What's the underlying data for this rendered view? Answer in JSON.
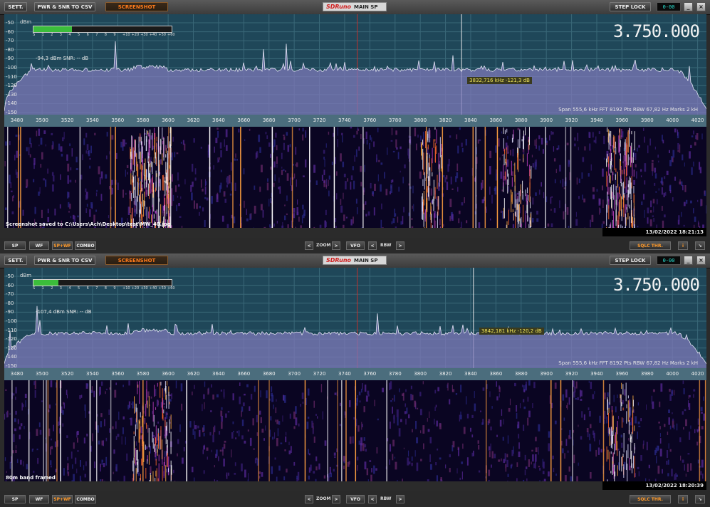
{
  "panels": [
    {
      "toolbar": {
        "sett": "SETT.",
        "pwr_csv": "PWR & SNR TO CSV",
        "screenshot": "SCREENSHOT",
        "brand": "SDRuno",
        "main_sp": "MAIN SP",
        "step_lock": "STEP LOCK",
        "squelch": "0-00",
        "minimize": "_",
        "close": "×"
      },
      "spectrum": {
        "y_labels": [
          "-50",
          "-60",
          "-70",
          "-80",
          "-90",
          "-100",
          "-110",
          "-120",
          "-130",
          "-140",
          "-150"
        ],
        "dbm_label": "dBm",
        "s_scale": [
          "S",
          "1",
          "2",
          "3",
          "4",
          "5",
          "6",
          "7",
          "8",
          "9",
          "+10",
          "+20",
          "+30",
          "+40",
          "+50",
          "+60"
        ],
        "signal_fraction": 0.28,
        "reading": "-94,3 dBm   SNR: -- dB",
        "frequency": "3.750.000",
        "cursor_label": "3832,716 kHz -121,3 dB",
        "cursor_frequency": 3832.716,
        "info": "Span 555,6 kHz   FFT 8192 Pts   RBW 67,82 Hz   Marks 2 kH"
      },
      "x_labels": [
        "3480",
        "3500",
        "3520",
        "3540",
        "3560",
        "3580",
        "3600",
        "3620",
        "3640",
        "3660",
        "3680",
        "3700",
        "3720",
        "3740",
        "3760",
        "3780",
        "3800",
        "3820",
        "3840",
        "3860",
        "3880",
        "3900",
        "3920",
        "3940",
        "3960",
        "3980",
        "4000",
        "4020"
      ],
      "waterfall_message": "Screenshot saved to C:\\Users\\Ach\\Desktop\\test\\MW_40.jpg",
      "timestamp": "13/02/2022 18:21:13",
      "bottom": {
        "sp": "SP",
        "wf": "WF",
        "spwf": "SP+WF",
        "combo": "COMBO",
        "zoom": "ZOOM",
        "vfo": "VFO",
        "rbw": "RBW",
        "prev": "<",
        "next": ">",
        "sqlc": "SQLC THR.",
        "info": "i",
        "resize": "↘"
      }
    },
    {
      "toolbar": {
        "sett": "SETT.",
        "pwr_csv": "PWR & SNR TO CSV",
        "screenshot": "SCREENSHOT",
        "brand": "SDRuno",
        "main_sp": "MAIN SP",
        "step_lock": "STEP LOCK",
        "squelch": "0-00",
        "minimize": "_",
        "close": "×"
      },
      "spectrum": {
        "y_labels": [
          "-50",
          "-60",
          "-70",
          "-80",
          "-90",
          "-100",
          "-110",
          "-120",
          "-130",
          "-140",
          "-150"
        ],
        "dbm_label": "dBm",
        "s_scale": [
          "S",
          "1",
          "2",
          "3",
          "4",
          "5",
          "6",
          "7",
          "8",
          "9",
          "+10",
          "+20",
          "+30",
          "+40",
          "+50",
          "+60"
        ],
        "signal_fraction": 0.18,
        "reading": "-107,4 dBm   SNR: -- dB",
        "frequency": "3.750.000",
        "cursor_label": "3842,181 kHz -120,2 dB",
        "cursor_frequency": 3842.181,
        "info": "Span 555,6 kHz   FFT 8192 Pts   RBW 67,82 Hz   Marks 2 kH"
      },
      "x_labels": [
        "3480",
        "3500",
        "3520",
        "3540",
        "3560",
        "3580",
        "3600",
        "3620",
        "3640",
        "3660",
        "3680",
        "3700",
        "3720",
        "3740",
        "3760",
        "3780",
        "3800",
        "3820",
        "3840",
        "3860",
        "3880",
        "3900",
        "3920",
        "3940",
        "3960",
        "3980",
        "4000",
        "4020"
      ],
      "waterfall_message": "80m band framed",
      "timestamp": "13/02/2022 18:20:39",
      "bottom": {
        "sp": "SP",
        "wf": "WF",
        "spwf": "SP+WF",
        "combo": "COMBO",
        "zoom": "ZOOM",
        "vfo": "VFO",
        "rbw": "RBW",
        "prev": "<",
        "next": ">",
        "sqlc": "SQLC THR.",
        "info": "i",
        "resize": "↘"
      }
    }
  ],
  "colors": {
    "spectrum_bg": "#1f4759",
    "trace_fill": "#7d78b8",
    "waterfall_bg": "#0a0522",
    "accent_orange": "#ff9a2a",
    "freq_text": "#f2f2f2",
    "signal_green": "#3bbd3b"
  }
}
